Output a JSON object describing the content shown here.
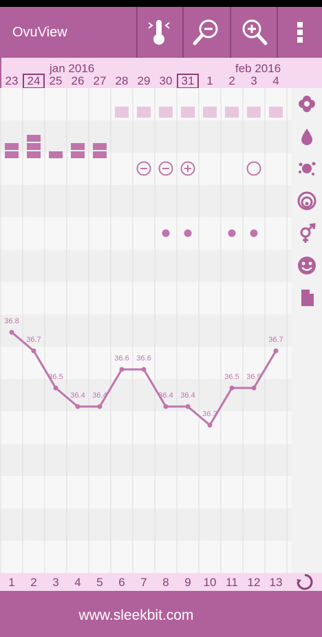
{
  "app": {
    "title": "OvuView",
    "footer_url": "www.sleekbit.com"
  },
  "toolbar": {
    "buttons": [
      {
        "icon": "thermometer-icon"
      },
      {
        "icon": "zoom-out-icon"
      },
      {
        "icon": "zoom-in-icon"
      },
      {
        "icon": "overflow-menu-icon"
      }
    ]
  },
  "calendar": {
    "month_labels": [
      {
        "text": "jan 2016"
      },
      {
        "text": "feb 2016"
      }
    ],
    "days": [
      "23",
      "24",
      "25",
      "26",
      "27",
      "28",
      "29",
      "30",
      "31",
      "1",
      "2",
      "3",
      "4"
    ],
    "today_boxed": [
      "24",
      "31"
    ],
    "cycle_days": [
      "1",
      "2",
      "3",
      "4",
      "5",
      "6",
      "7",
      "8",
      "9",
      "10",
      "11",
      "12",
      "13"
    ]
  },
  "rows": {
    "period_forecast": [
      false,
      false,
      false,
      false,
      false,
      true,
      true,
      true,
      true,
      true,
      true,
      true,
      true
    ],
    "flow_level": [
      2,
      3,
      1,
      2,
      2,
      0,
      0,
      0,
      0,
      0,
      0,
      0,
      0
    ],
    "tests": [
      "",
      "",
      "",
      "",
      "",
      "",
      "minus",
      "minus",
      "plus",
      "",
      "",
      "circle",
      ""
    ],
    "intercourse": [
      false,
      false,
      false,
      false,
      false,
      false,
      false,
      true,
      true,
      false,
      true,
      true,
      false
    ]
  },
  "side_icons": [
    "flower-icon",
    "drop-icon",
    "splat-icon",
    "cervix-icon",
    "gender-icon",
    "smiley-icon",
    "note-icon"
  ],
  "cycle_icon": "cycle-refresh-icon",
  "colors": {
    "accent": "#b0609a",
    "light": "#f6d9ef",
    "text": "#8a3f77",
    "mark": "#bf75ab"
  },
  "chart_data": {
    "type": "line",
    "x": [
      "1",
      "2",
      "3",
      "4",
      "5",
      "6",
      "7",
      "8",
      "9",
      "10",
      "11",
      "12",
      "13"
    ],
    "series": [
      {
        "values": [
          36.8,
          36.7,
          36.5,
          36.4,
          36.4,
          36.6,
          36.6,
          36.4,
          36.4,
          36.3,
          36.5,
          36.5,
          36.7
        ]
      }
    ],
    "labels": [
      "36.8",
      "36.7",
      "36.5",
      "36.4",
      "36.4",
      "36.6",
      "36.6",
      "36.4",
      "36.4",
      "36.3",
      "36.5",
      "36.5",
      "36.7"
    ],
    "grid": true
  }
}
